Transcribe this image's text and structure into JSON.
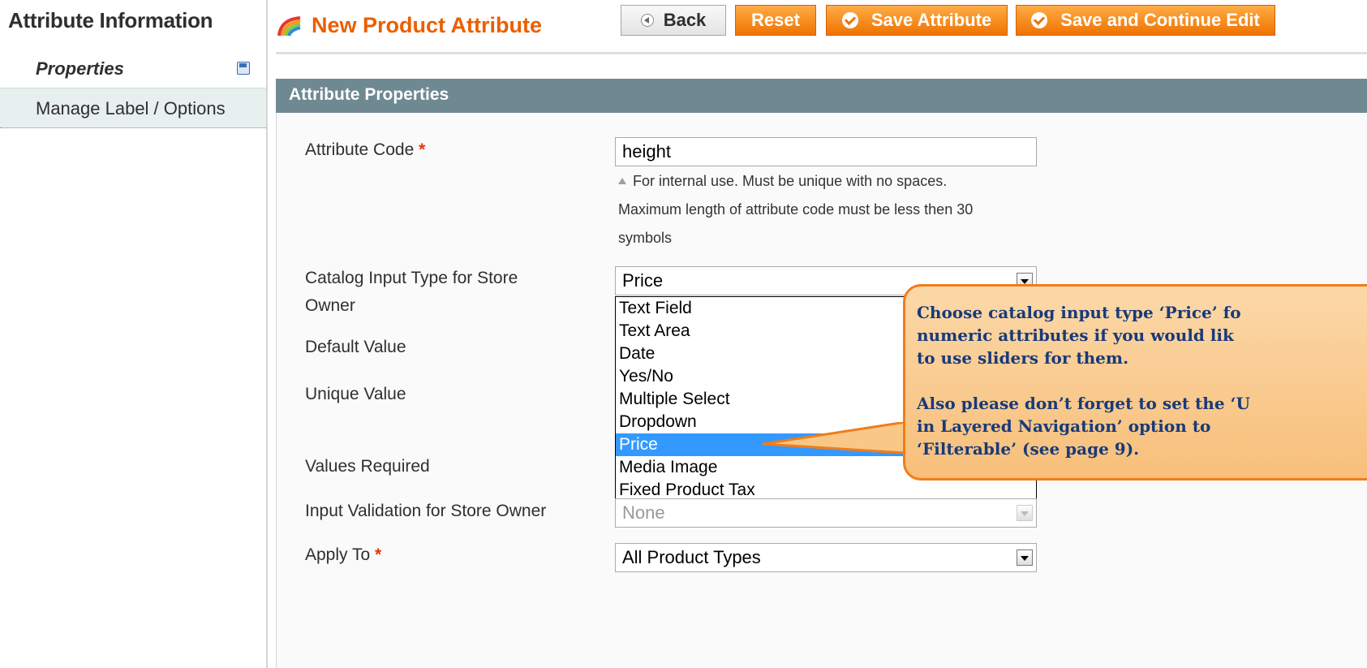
{
  "sidebar": {
    "title": "Attribute Information",
    "items": [
      {
        "label": "Properties"
      },
      {
        "label": "Manage Label / Options"
      }
    ]
  },
  "header": {
    "title": "New Product Attribute",
    "buttons": {
      "back": "Back",
      "reset": "Reset",
      "save": "Save Attribute",
      "save_continue": "Save and Continue Edit"
    }
  },
  "section": {
    "title": "Attribute Properties"
  },
  "form": {
    "attribute_code": {
      "label": "Attribute Code",
      "required_mark": "*",
      "value": "height",
      "note_lines": [
        "For internal use. Must be unique with no spaces.",
        "Maximum length of attribute code must be less then 30",
        "symbols"
      ]
    },
    "input_type": {
      "label_line1": "Catalog Input Type for Store",
      "label_line2": "Owner",
      "value": "Price",
      "options": [
        "Text Field",
        "Text Area",
        "Date",
        "Yes/No",
        "Multiple Select",
        "Dropdown",
        "Price",
        "Media Image",
        "Fixed Product Tax"
      ],
      "selected": "Price"
    },
    "default_value": {
      "label": "Default Value"
    },
    "unique_value": {
      "label": "Unique Value"
    },
    "values_required": {
      "label": "Values Required"
    },
    "input_validation": {
      "label": "Input Validation for Store Owner",
      "value": "None"
    },
    "apply_to": {
      "label": "Apply To",
      "required_mark": "*",
      "value": "All Product Types"
    }
  },
  "callout": {
    "para1": [
      "Choose catalog input type ‘Price’ fo",
      "numeric attributes if you would lik",
      "to use sliders for them."
    ],
    "para2": [
      "Also please don’t forget to set the ‘U",
      "in Layered Navigation’ option to",
      "‘Filterable’ (see page 9)."
    ]
  },
  "colors": {
    "accent_orange": "#eb5e00",
    "section_header": "#6f8992",
    "selection_blue": "#3399ff",
    "callout_border": "#f07d1a",
    "callout_text": "#173a7a"
  }
}
